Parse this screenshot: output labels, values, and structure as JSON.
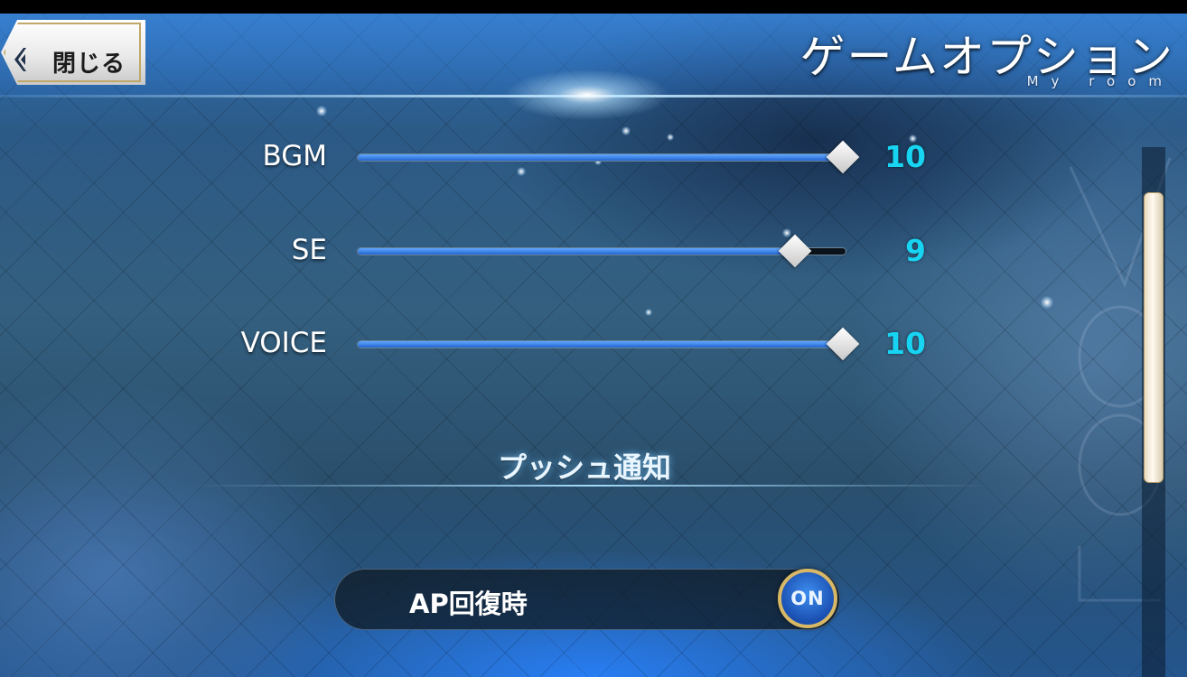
{
  "header": {
    "close_label": "閉じる",
    "title": "ゲームオプション",
    "subtitle": "My room"
  },
  "sliders": [
    {
      "label": "BGM",
      "value": "10",
      "level": 1.0
    },
    {
      "label": "SE",
      "value": "9",
      "level": 0.9
    },
    {
      "label": "VOICE",
      "value": "10",
      "level": 1.0
    }
  ],
  "push": {
    "title": "プッシュ通知",
    "ap_label": "AP回復時",
    "ap_toggle": "ON"
  },
  "colors": {
    "value_text": "#17d4f2",
    "slider_fill": "#2465d0",
    "toggle_ring": "#d8b866"
  }
}
